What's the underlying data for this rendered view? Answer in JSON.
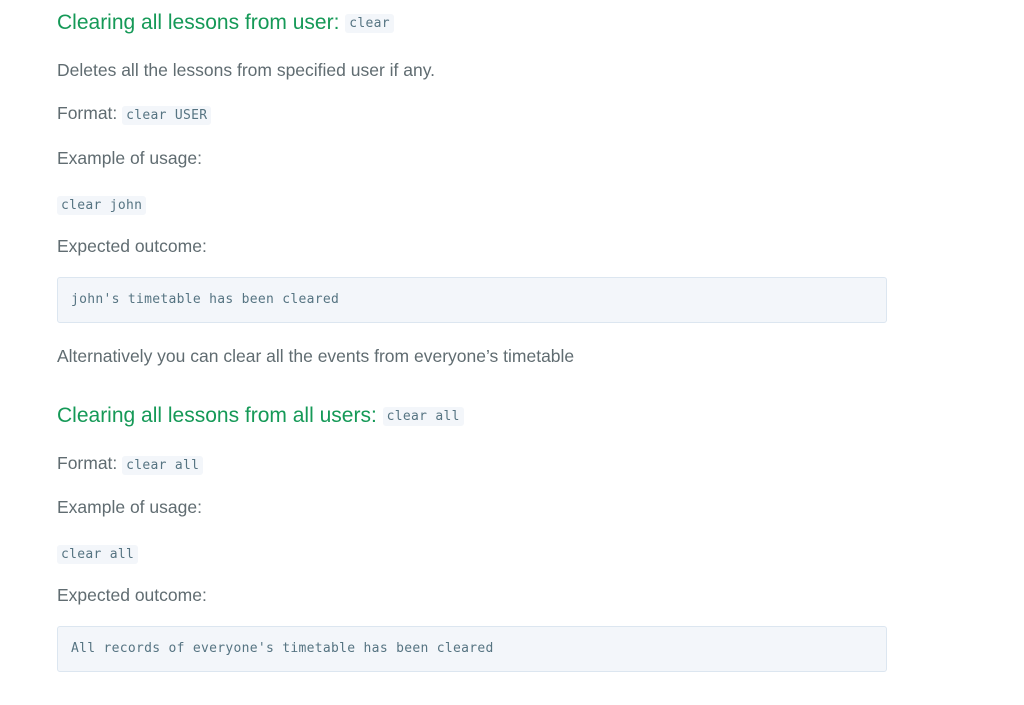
{
  "section1": {
    "heading": "Clearing all lessons from user: ",
    "heading_code": "clear",
    "description": "Deletes all the lessons from specified user if any.",
    "format_label": "Format: ",
    "format_code": "clear USER",
    "example_label": "Example of usage:",
    "example_code": "clear john",
    "outcome_label": "Expected outcome:",
    "outcome_output": "john's timetable has been cleared"
  },
  "transition": "Alternatively you can clear all the events from everyone’s timetable",
  "section2": {
    "heading": "Clearing all lessons from all users: ",
    "heading_code": "clear all",
    "format_label": "Format: ",
    "format_code": "clear all",
    "example_label": "Example of usage:",
    "example_code": "clear all",
    "outcome_label": "Expected outcome:",
    "outcome_output": "All records of everyone's timetable has been cleared"
  }
}
